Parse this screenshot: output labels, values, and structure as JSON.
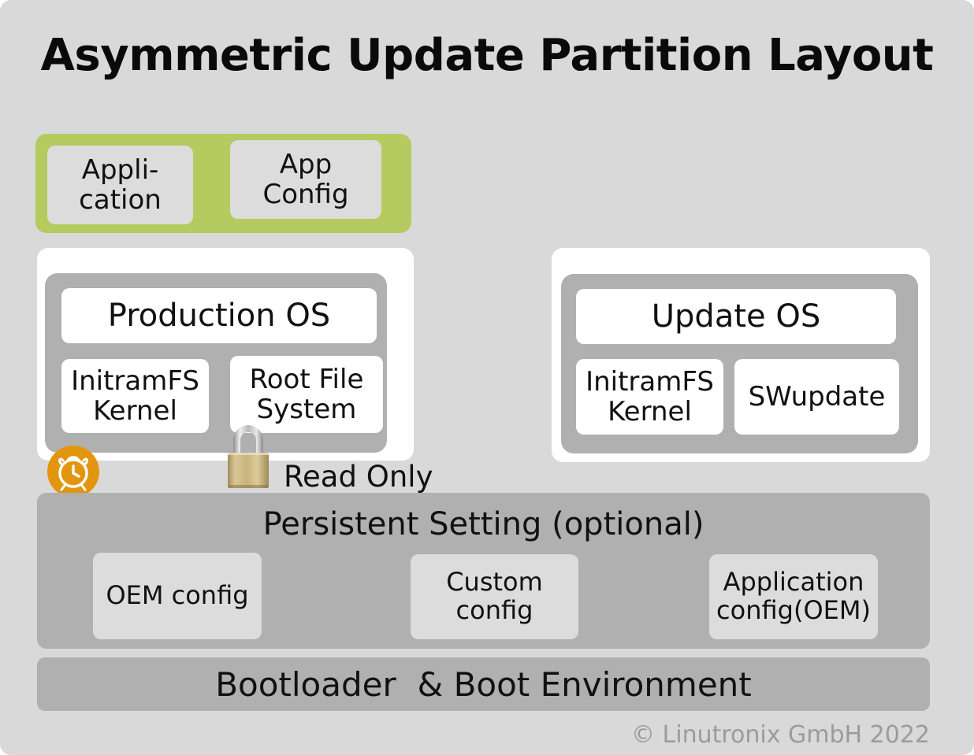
{
  "title": "Asymmetric Update Partition Layout",
  "colors": {
    "canvas_background": "#d9d9d9",
    "application_band": "#b5ca5f",
    "gray_band": "#b0b0b0",
    "box_light": "#dcdcdc",
    "box_white": "#ffffff",
    "clock_accent": "#e2960f",
    "lock_brass": "#c3ab74",
    "footer_text": "#9b9b9b"
  },
  "application_band": {
    "boxes": [
      {
        "line1": "Appli-",
        "line2": "cation"
      },
      {
        "line1": "App",
        "line2": "Config"
      }
    ]
  },
  "production": {
    "os_label": "Production OS",
    "boxes": [
      {
        "line1": "InitramFS",
        "line2": "Kernel"
      },
      {
        "line1": "Root File",
        "line2": "System"
      }
    ]
  },
  "update": {
    "os_label": "Update OS",
    "boxes": [
      {
        "line1": "InitramFS",
        "line2": "Kernel"
      },
      {
        "line1": "SWupdate",
        "line2": ""
      }
    ]
  },
  "annotation": {
    "read_only_label": "Read Only",
    "clock_icon_name": "alarm-clock-icon",
    "lock_icon_name": "padlock-icon"
  },
  "persistent": {
    "title": "Persistent Setting (optional)",
    "boxes": [
      {
        "line1": "OEM config",
        "line2": ""
      },
      {
        "line1": "Custom",
        "line2": "config"
      },
      {
        "line1": "Application",
        "line2": "config(OEM)"
      }
    ]
  },
  "bootloader": {
    "label": "Bootloader  & Boot Environment"
  },
  "footer": {
    "copyright": "© Linutronix GmbH 2022"
  }
}
